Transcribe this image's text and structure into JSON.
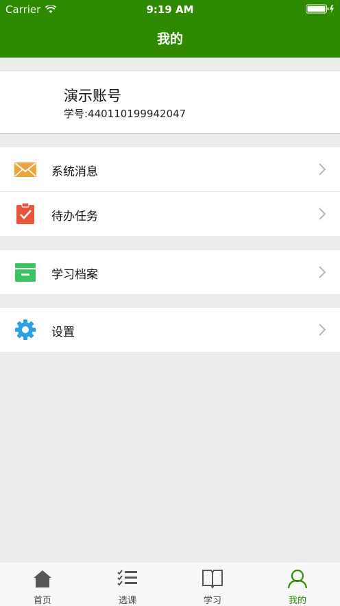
{
  "status_bar": {
    "carrier": "Carrier",
    "time": "9:19 AM"
  },
  "header": {
    "title": "我的"
  },
  "profile": {
    "name": "演示账号",
    "student_id": "学号:440110199942047"
  },
  "menu": {
    "messages": "系统消息",
    "todo": "待办任务",
    "records": "学习档案",
    "settings": "设置"
  },
  "tabs": [
    {
      "label": "首页",
      "icon": "home-icon"
    },
    {
      "label": "选课",
      "icon": "checklist-icon"
    },
    {
      "label": "学习",
      "icon": "book-icon"
    },
    {
      "label": "我的",
      "icon": "person-icon",
      "active": true
    }
  ],
  "colors": {
    "brand": "#2e8b00",
    "mail": "#f0a33a",
    "task": "#e8543a",
    "archive": "#3cc463",
    "gear": "#2aa3e0"
  }
}
